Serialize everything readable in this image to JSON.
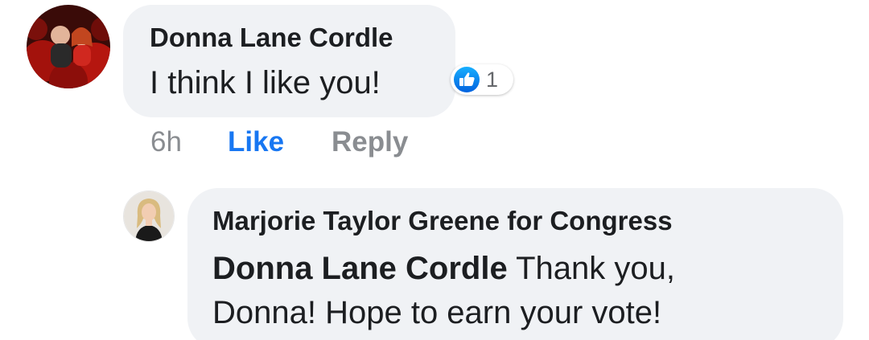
{
  "comment": {
    "author": "Donna Lane Cordle",
    "text": "I think I like you!",
    "reaction_count": "1",
    "reaction_icon": "like-icon",
    "timestamp": "6h",
    "like_label": "Like",
    "reply_label": "Reply"
  },
  "reply": {
    "author": "Marjorie Taylor Greene for Congress",
    "mention": "Donna Lane Cordle",
    "text_line1": " Thank you,",
    "text_line2": "Donna! Hope to earn your vote!"
  },
  "colors": {
    "bubble": "#f0f2f5",
    "link_blue": "#1877f2",
    "meta_gray": "#8a8d91",
    "text": "#1c1e21"
  }
}
